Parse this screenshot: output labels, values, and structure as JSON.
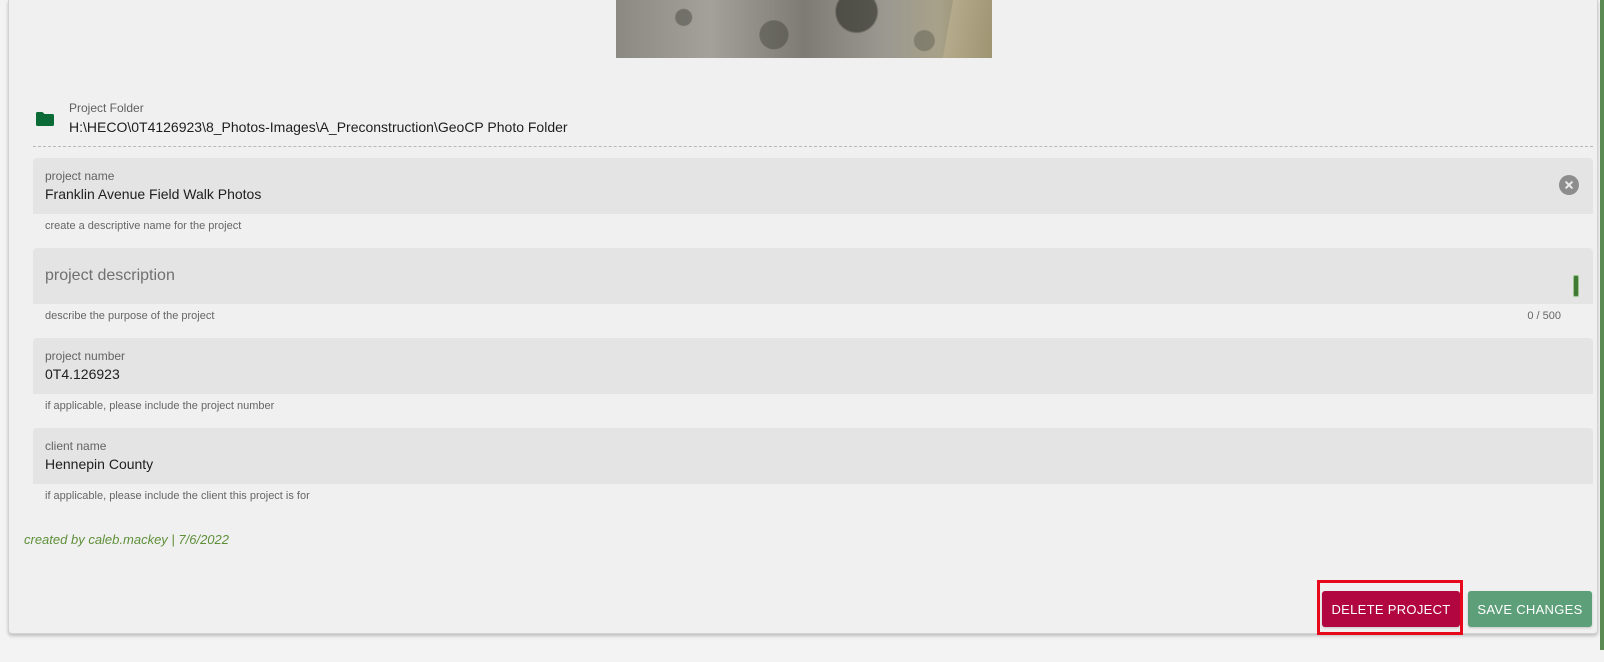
{
  "folder": {
    "label": "Project Folder",
    "path": "H:\\HECO\\0T4126923\\8_Photos-Images\\A_Preconstruction\\GeoCP Photo Folder",
    "icon": "folder-icon",
    "icon_color": "#0b6b36"
  },
  "fields": {
    "project_name": {
      "label": "project name",
      "value": "Franklin Avenue Field Walk Photos",
      "hint": "create a descriptive name for the project"
    },
    "project_description": {
      "placeholder": "project description",
      "hint": "describe the purpose of the project",
      "counter": "0 / 500"
    },
    "project_number": {
      "label": "project number",
      "value": "0T4.126923",
      "hint": "if applicable, please include the project number"
    },
    "client_name": {
      "label": "client name",
      "value": "Hennepin County",
      "hint": "if applicable, please include the client this project is for"
    }
  },
  "created_info": "created by caleb.mackey | 7/6/2022",
  "actions": {
    "delete_label": "DELETE PROJECT",
    "save_label": "SAVE CHANGES"
  },
  "colors": {
    "delete_button": "#b1063f",
    "save_button": "#5c9f78",
    "highlight_frame": "#e8081c",
    "created_text": "#5e8f39"
  }
}
